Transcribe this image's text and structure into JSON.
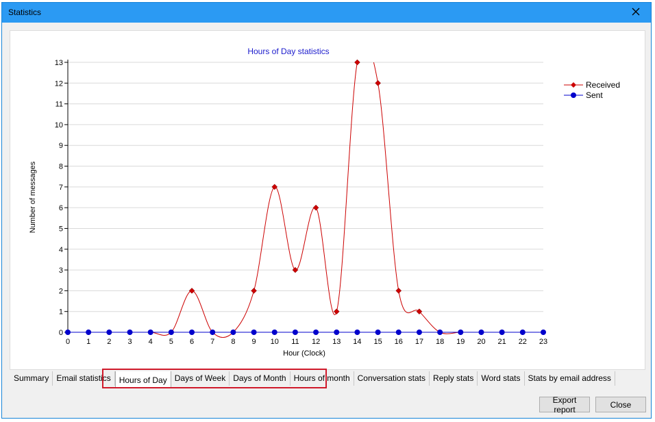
{
  "window": {
    "title": "Statistics"
  },
  "tabs": [
    {
      "label": "Summary"
    },
    {
      "label": "Email statistics"
    },
    {
      "label": "Hours of Day",
      "active": true
    },
    {
      "label": "Days of Week"
    },
    {
      "label": "Days of Month"
    },
    {
      "label": "Hours of month"
    },
    {
      "label": "Conversation stats"
    },
    {
      "label": "Reply stats"
    },
    {
      "label": "Word stats"
    },
    {
      "label": "Stats by email address"
    }
  ],
  "buttons": {
    "export": "Export report",
    "close": "Close"
  },
  "colors": {
    "received": "#cc0000",
    "sent": "#0000cc",
    "title": "#1a1acc",
    "highlight": "#d0192a",
    "titlebar": "#2b9af3"
  },
  "icons": {
    "close": "close-icon"
  },
  "chart_data": {
    "type": "line",
    "title": "Hours of Day statistics",
    "xlabel": "Hour (Clock)",
    "ylabel": "Number of messages",
    "x": [
      0,
      1,
      2,
      3,
      4,
      5,
      6,
      7,
      8,
      9,
      10,
      11,
      12,
      13,
      14,
      15,
      16,
      17,
      18,
      19,
      20,
      21,
      22,
      23
    ],
    "ylim": [
      0,
      13
    ],
    "yticks": [
      0,
      1,
      2,
      3,
      4,
      5,
      6,
      7,
      8,
      9,
      10,
      11,
      12,
      13
    ],
    "grid": true,
    "legend_position": "top-right",
    "series": [
      {
        "name": "Received",
        "marker": "diamond",
        "values": [
          0,
          0,
          0,
          0,
          0,
          0,
          2,
          0,
          0,
          2,
          7,
          3,
          6,
          1,
          13,
          12,
          2,
          1,
          0,
          0,
          0,
          0,
          0,
          0
        ]
      },
      {
        "name": "Sent",
        "marker": "circle",
        "values": [
          0,
          0,
          0,
          0,
          0,
          0,
          0,
          0,
          0,
          0,
          0,
          0,
          0,
          0,
          0,
          0,
          0,
          0,
          0,
          0,
          0,
          0,
          0,
          0
        ]
      }
    ]
  }
}
